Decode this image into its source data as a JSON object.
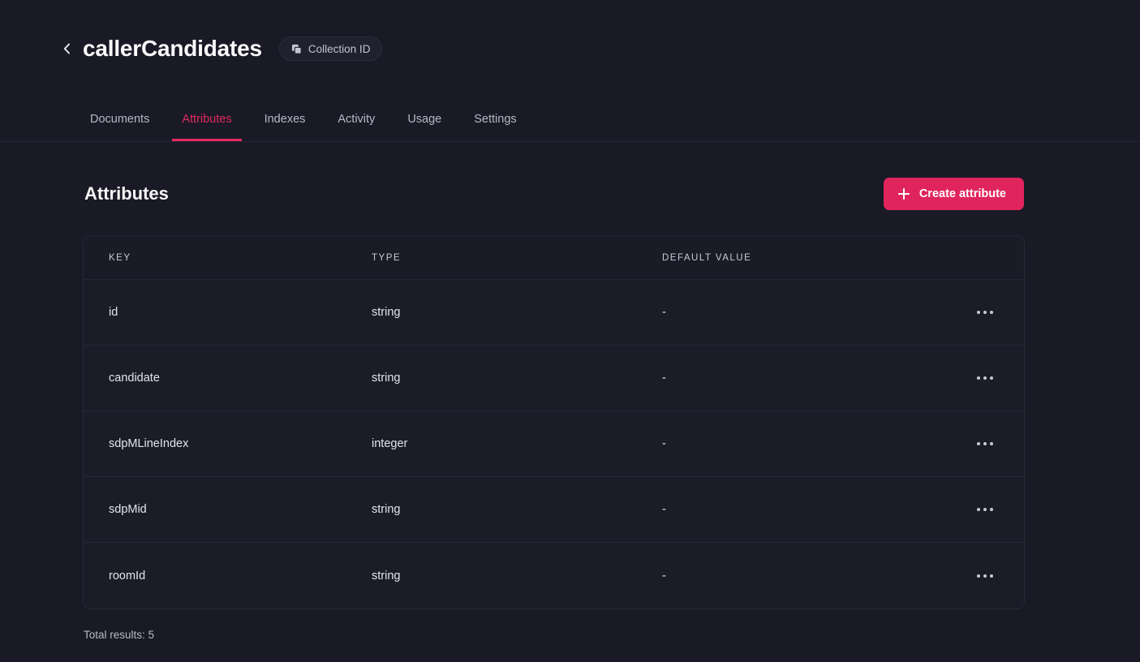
{
  "header": {
    "back_icon": "chevron-left-icon",
    "title": "callerCandidates",
    "collection_id_pill": {
      "icon": "copy-icon",
      "label": "Collection ID"
    }
  },
  "tabs": [
    {
      "label": "Documents",
      "active": false
    },
    {
      "label": "Attributes",
      "active": true
    },
    {
      "label": "Indexes",
      "active": false
    },
    {
      "label": "Activity",
      "active": false
    },
    {
      "label": "Usage",
      "active": false
    },
    {
      "label": "Settings",
      "active": false
    }
  ],
  "section": {
    "title": "Attributes",
    "create_button": {
      "label": "Create attribute",
      "icon": "plus-icon"
    }
  },
  "table": {
    "columns": [
      "KEY",
      "TYPE",
      "DEFAULT VALUE"
    ],
    "rows": [
      {
        "key": "id",
        "type": "string",
        "default": "-",
        "menu_icon": "ellipsis-icon"
      },
      {
        "key": "candidate",
        "type": "string",
        "default": "-",
        "menu_icon": "ellipsis-icon"
      },
      {
        "key": "sdpMLineIndex",
        "type": "integer",
        "default": "-",
        "menu_icon": "ellipsis-icon"
      },
      {
        "key": "sdpMid",
        "type": "string",
        "default": "-",
        "menu_icon": "ellipsis-icon"
      },
      {
        "key": "roomId",
        "type": "string",
        "default": "-",
        "menu_icon": "ellipsis-icon"
      }
    ]
  },
  "footer": {
    "total_results": "Total results: 5"
  },
  "colors": {
    "page_background": "#1a1a26",
    "card_background": "#1c1c29",
    "border": "#262636",
    "accent": "#e0255c",
    "accent_tab": "#e02a5e",
    "text_primary": "#f5f5f7",
    "text_secondary": "#b6b8c5"
  }
}
